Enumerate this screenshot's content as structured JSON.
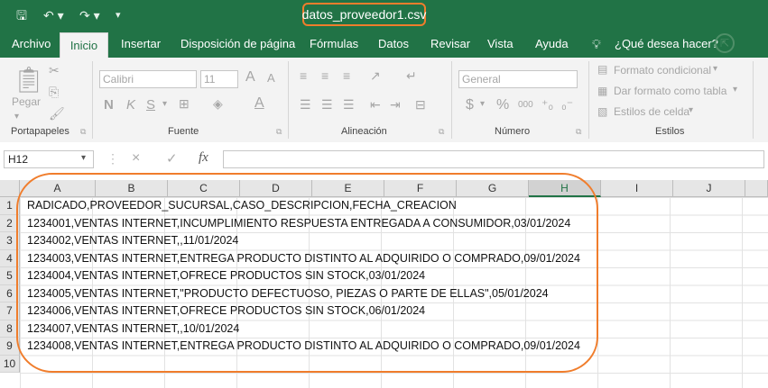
{
  "window": {
    "title": "datos_proveedor1.csv",
    "qat": {
      "save_icon": "save-icon",
      "undo_icon": "undo-icon",
      "redo_icon": "redo-icon",
      "customize_icon": "customize-qat-icon"
    }
  },
  "tabs": [
    {
      "label": "Archivo"
    },
    {
      "label": "Inicio",
      "active": true
    },
    {
      "label": "Insertar"
    },
    {
      "label": "Disposición de página"
    },
    {
      "label": "Fórmulas"
    },
    {
      "label": "Datos"
    },
    {
      "label": "Revisar"
    },
    {
      "label": "Vista"
    },
    {
      "label": "Ayuda"
    },
    {
      "label": "¿Qué desea hacer?"
    }
  ],
  "ribbon": {
    "clipboard": {
      "paste_label": "Pegar",
      "group_label": "Portapapeles"
    },
    "font": {
      "font_name": "Calibri",
      "font_size": "11",
      "bold": "N",
      "italic": "K",
      "underline": "S",
      "grow": "A",
      "shrink": "A",
      "font_color": "A",
      "group_label": "Fuente"
    },
    "alignment": {
      "group_label": "Alineación"
    },
    "number": {
      "format": "General",
      "currency": "$",
      "percent": "%",
      "thousands": "000",
      "group_label": "Número"
    },
    "styles": {
      "conditional": "Formato condicional",
      "as_table": "Dar formato como tabla",
      "cell_styles": "Estilos de celda",
      "group_label": "Estilos"
    }
  },
  "formula_bar": {
    "name_box": "H12",
    "cancel": "×",
    "enter": "✓",
    "fx": "fx",
    "value": ""
  },
  "sheet": {
    "columns": [
      "A",
      "B",
      "C",
      "D",
      "E",
      "F",
      "G",
      "H",
      "I",
      "J"
    ],
    "selected_column": "H",
    "rows": [
      "1",
      "2",
      "3",
      "4",
      "5",
      "6",
      "7",
      "8",
      "9",
      "10"
    ],
    "cells": [
      "RADICADO,PROVEEDOR_SUCURSAL,CASO_DESCRIPCION,FECHA_CREACION",
      "1234001,VENTAS INTERNET,INCUMPLIMIENTO RESPUESTA ENTREGADA A CONSUMIDOR,03/01/2024",
      "1234002,VENTAS INTERNET,,11/01/2024",
      "1234003,VENTAS INTERNET,ENTREGA PRODUCTO DISTINTO AL ADQUIRIDO O COMPRADO,09/01/2024",
      "1234004,VENTAS INTERNET,OFRECE PRODUCTOS SIN STOCK,03/01/2024",
      "1234005,VENTAS INTERNET,\"PRODUCTO DEFECTUOSO, PIEZAS O PARTE DE ELLAS\",05/01/2024",
      "1234006,VENTAS INTERNET,OFRECE PRODUCTOS SIN STOCK,06/01/2024",
      "1234007,VENTAS INTERNET,,10/01/2024",
      "1234008,VENTAS INTERNET,ENTREGA PRODUCTO DISTINTO AL ADQUIRIDO O COMPRADO,09/01/2024",
      ""
    ]
  },
  "colors": {
    "excel_green": "#217346",
    "annotation_orange": "#f07d2c"
  }
}
